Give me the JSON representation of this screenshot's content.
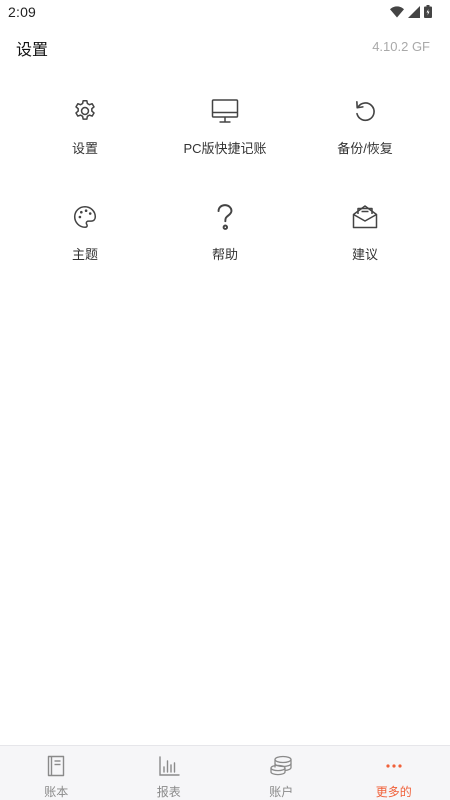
{
  "status_bar": {
    "time": "2:09",
    "icons": [
      "wifi-icon",
      "signal-icon",
      "battery-icon"
    ]
  },
  "header": {
    "title": "设置",
    "version": "4.10.2 GF"
  },
  "menu": {
    "items": [
      {
        "label": "设置",
        "icon": "gear-icon"
      },
      {
        "label": "PC版快捷记账",
        "icon": "monitor-icon"
      },
      {
        "label": "备份/恢复",
        "icon": "restore-icon"
      },
      {
        "label": "主题",
        "icon": "palette-icon"
      },
      {
        "label": "帮助",
        "icon": "question-icon"
      },
      {
        "label": "建议",
        "icon": "mail-open-icon"
      }
    ]
  },
  "bottom_nav": {
    "items": [
      {
        "label": "账本",
        "icon": "book-icon",
        "active": false
      },
      {
        "label": "报表",
        "icon": "bar-chart-icon",
        "active": false
      },
      {
        "label": "账户",
        "icon": "coins-icon",
        "active": false
      },
      {
        "label": "更多的",
        "icon": "more-dots-icon",
        "active": true
      }
    ]
  },
  "colors": {
    "accent": "#f0613a",
    "icon": "#444444",
    "nav_inactive": "#8a8a8a",
    "version_text": "#a9a9a9"
  }
}
